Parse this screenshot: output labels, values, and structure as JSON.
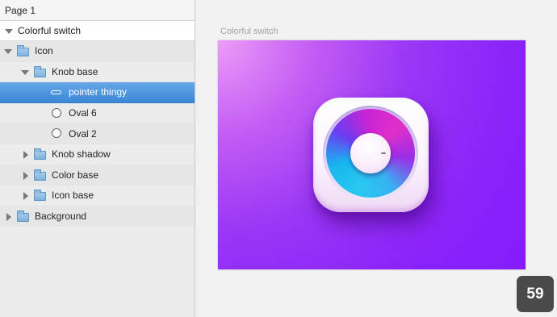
{
  "layers_panel": {
    "page_label": "Page 1",
    "artboard_label": "Colorful switch",
    "layers": [
      {
        "label": "Icon",
        "type": "group",
        "expanded": true
      },
      {
        "label": "Knob base",
        "type": "group",
        "expanded": true
      },
      {
        "label": "pointer thingy",
        "type": "shape",
        "selected": true
      },
      {
        "label": "Oval 6",
        "type": "oval"
      },
      {
        "label": "Oval 2",
        "type": "oval"
      },
      {
        "label": "Knob shadow",
        "type": "group",
        "expanded": false
      },
      {
        "label": "Color base",
        "type": "group",
        "expanded": false
      },
      {
        "label": "Icon base",
        "type": "group",
        "expanded": false
      },
      {
        "label": "Background",
        "type": "group",
        "expanded": false
      }
    ]
  },
  "canvas": {
    "artboard_title": "Colorful switch"
  },
  "badge": {
    "number": "59"
  },
  "colors": {
    "selection": "#3b86d8",
    "artboard_gradient_start": "#ee9cf9",
    "artboard_gradient_end": "#861cfa",
    "badge_background": "#4a4a4a"
  }
}
